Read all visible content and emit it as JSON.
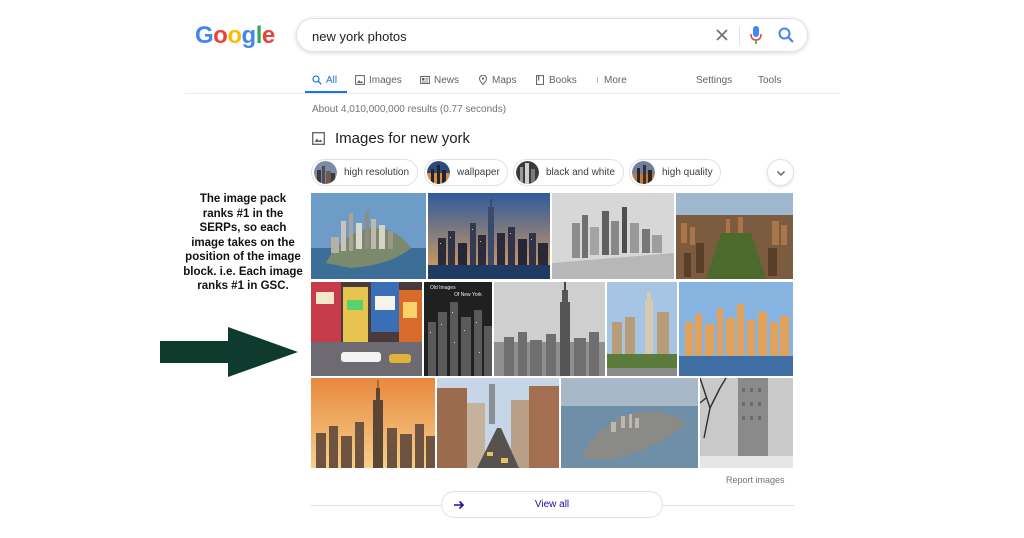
{
  "logo": {
    "g1": "G",
    "o1": "o",
    "o2": "o",
    "g2": "g",
    "l": "l",
    "e": "e"
  },
  "search": {
    "query": "new york photos"
  },
  "tabs": [
    {
      "label": "All",
      "icon": "search-icon"
    },
    {
      "label": "Images",
      "icon": "image-icon"
    },
    {
      "label": "News",
      "icon": "news-icon"
    },
    {
      "label": "Maps",
      "icon": "map-pin-icon"
    },
    {
      "label": "Books",
      "icon": "book-icon"
    },
    {
      "label": "More",
      "icon": "more-dots-icon"
    },
    {
      "label": "Settings"
    },
    {
      "label": "Tools"
    }
  ],
  "result_stats": "About 4,010,000,000 results (0.77 seconds)",
  "images_heading": "Images for new york",
  "chips": [
    "high resolution",
    "wallpaper",
    "black and white",
    "high quality"
  ],
  "photos": {
    "old_images_caption_1": "Old Images",
    "old_images_caption_2": "Of New York"
  },
  "report_images": "Report images",
  "view_all": "View all",
  "annotation": "The image pack ranks #1 in the SERPs, so each image takes on the position of the image block. i.e. Each image ranks #1 in GSC.",
  "colors": {
    "accent": "#1a73e8",
    "arrow": "#0f3b2e",
    "link": "#1a0dab"
  }
}
